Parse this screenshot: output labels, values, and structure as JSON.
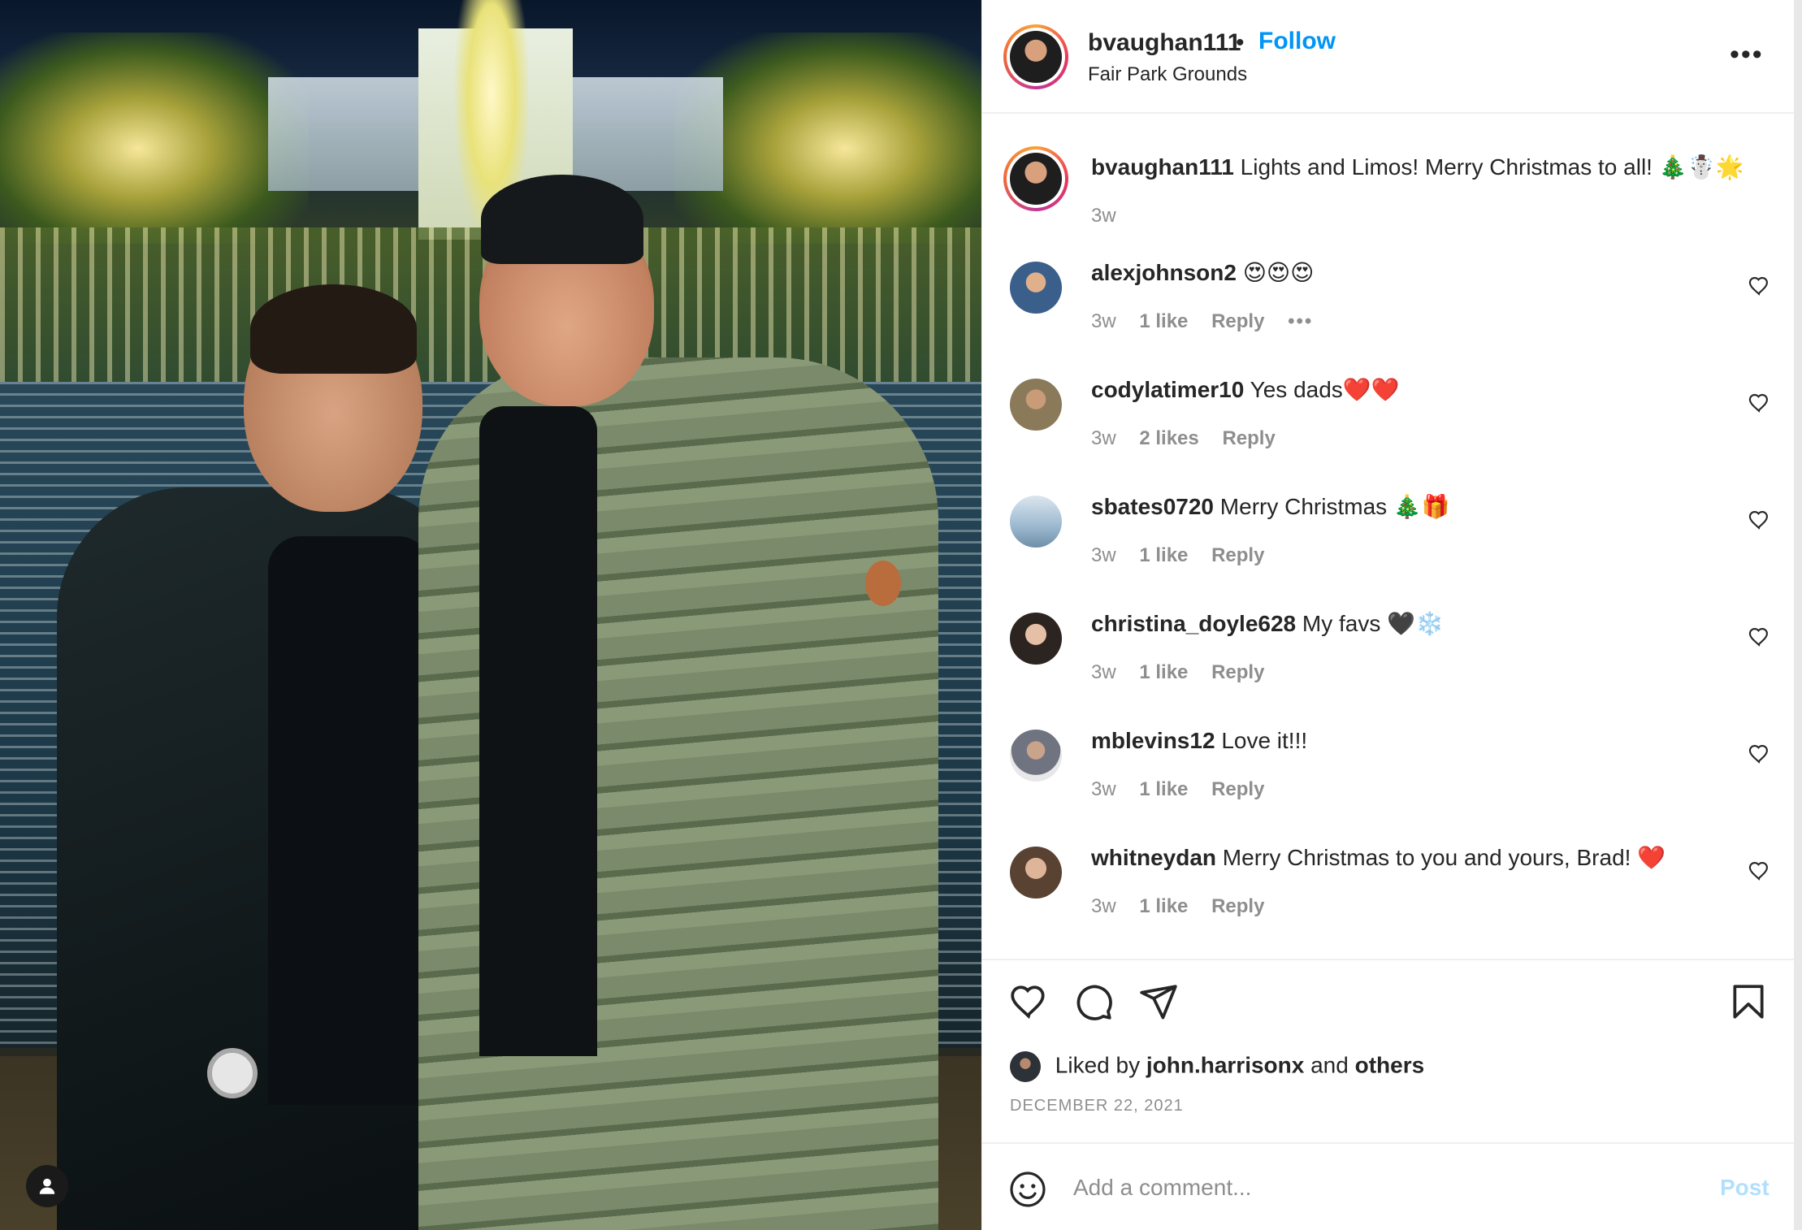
{
  "post": {
    "author": "bvaughan111",
    "follow_label": "Follow",
    "separator": "•",
    "location": "Fair Park Grounds",
    "more_label": "•••"
  },
  "caption": {
    "username": "bvaughan111",
    "text": "Lights and Limos! Merry Christmas to all! 🎄☃️🌟",
    "time": "3w"
  },
  "comments": [
    {
      "username": "alexjohnson2",
      "text": "😍😍😍",
      "time": "3w",
      "likes": "1 like",
      "reply": "Reply",
      "more": "•••",
      "avatar_color": "#3a5f8a"
    },
    {
      "username": "codylatimer10",
      "text": "Yes dads❤️❤️",
      "time": "3w",
      "likes": "2 likes",
      "reply": "Reply",
      "avatar_color": "#8a7a5a"
    },
    {
      "username": "sbates0720",
      "text": "Merry Christmas 🎄🎁",
      "time": "3w",
      "likes": "1 like",
      "reply": "Reply",
      "avatar_color": "#9bb8cf"
    },
    {
      "username": "christina_doyle628",
      "text": "My favs 🖤❄️",
      "time": "3w",
      "likes": "1 like",
      "reply": "Reply",
      "avatar_color": "#c9a58f"
    },
    {
      "username": "mblevins12",
      "text": "Love it!!!",
      "time": "3w",
      "likes": "1 like",
      "reply": "Reply",
      "avatar_color": "#6f7480"
    },
    {
      "username": "whitneydan",
      "text": "Merry Christmas to you and yours, Brad! ❤️",
      "time": "3w",
      "likes": "1 like",
      "reply": "Reply",
      "avatar_color": "#a07c63"
    }
  ],
  "engagement": {
    "liked_prefix": "Liked by",
    "liked_user": "john.harrisonx",
    "liked_and": "and",
    "liked_others": "others",
    "date": "DECEMBER 22, 2021"
  },
  "composer": {
    "placeholder": "Add a comment...",
    "post_label": "Post"
  },
  "colors": {
    "link_blue": "#0095f6",
    "post_disabled": "#b2dffc",
    "meta_gray": "#8e8e8e"
  },
  "icons": [
    "user-tag-icon",
    "more-options-icon",
    "heart-icon",
    "comment-icon",
    "share-icon",
    "bookmark-icon",
    "emoji-icon"
  ]
}
